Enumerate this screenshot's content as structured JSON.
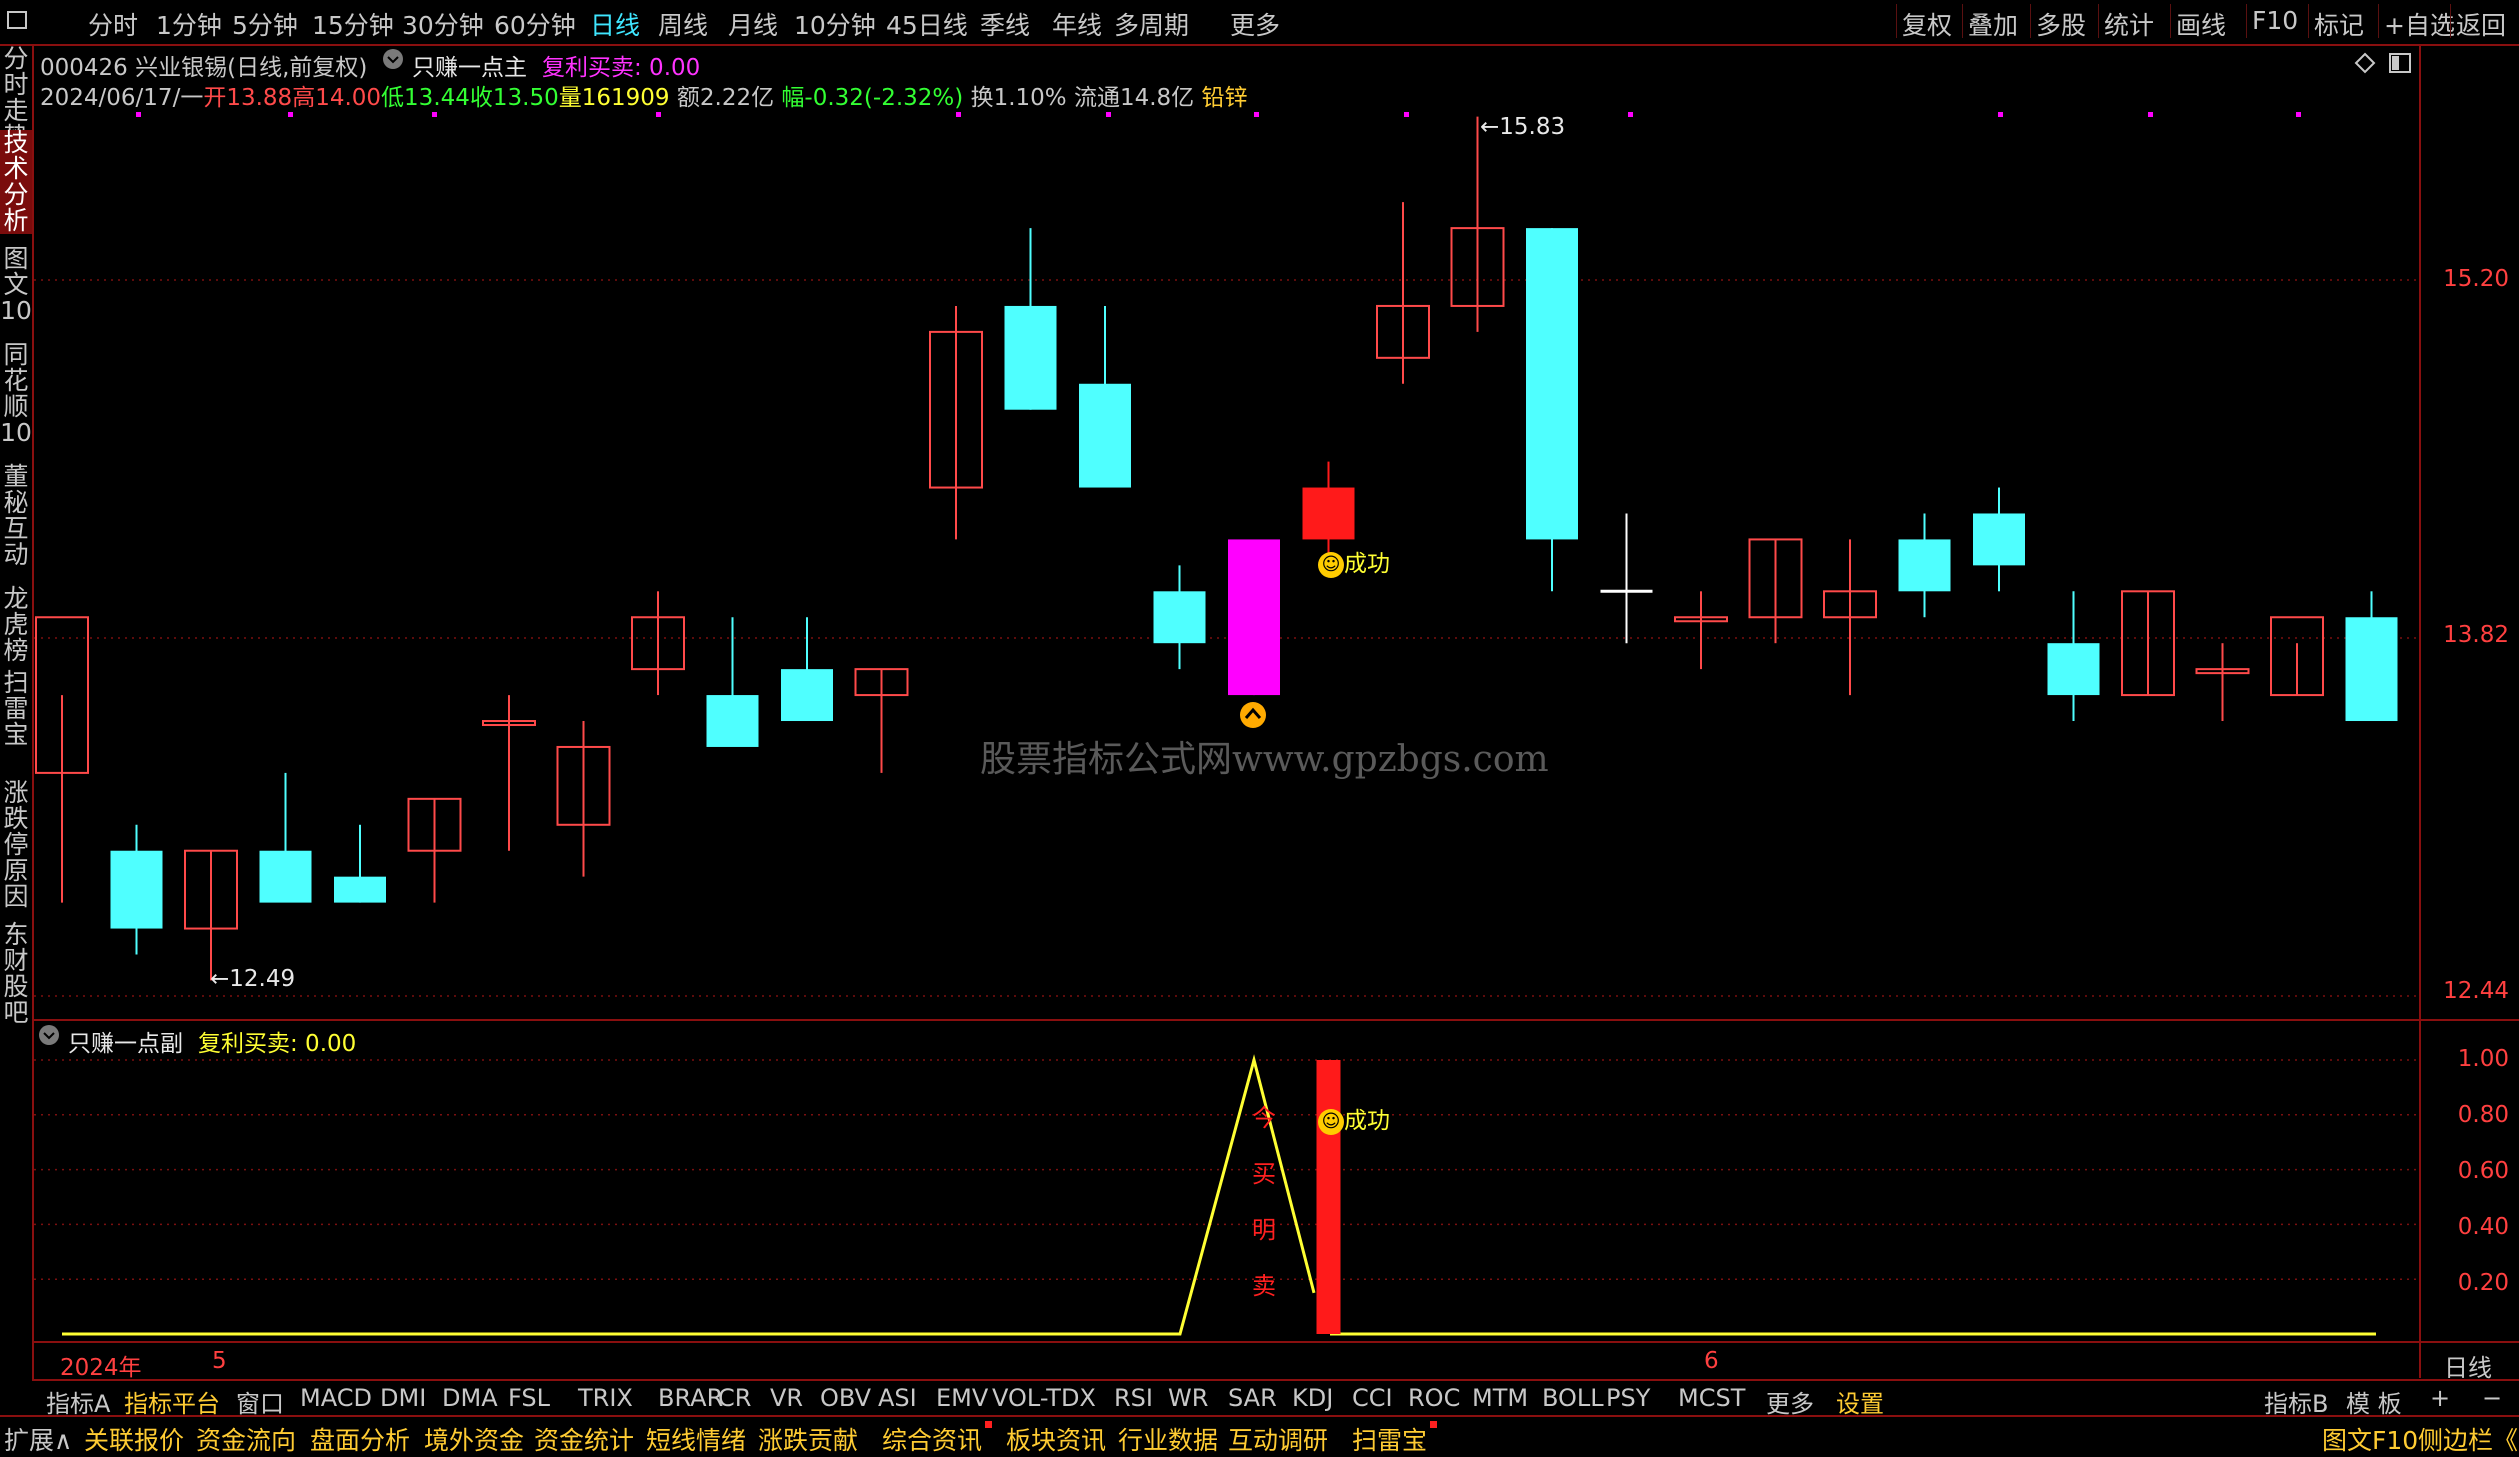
{
  "toolbar": {
    "periods": [
      "分时",
      "1分钟",
      "5分钟",
      "15分钟",
      "30分钟",
      "60分钟",
      "日线",
      "周线",
      "月线",
      "10分钟",
      "45日线",
      "季线",
      "年线",
      "多周期",
      "更多"
    ],
    "active_period": "日线",
    "right_tools": [
      "复权",
      "叠加",
      "多股",
      "统计",
      "画线",
      "F10",
      "标记",
      "+自选",
      "返回"
    ]
  },
  "left_tabs": [
    "分时走势",
    "技术分析",
    "图文10",
    "同花顺10",
    "董秘互动",
    "龙虎榜",
    "扫雷宝",
    "涨跌停原因",
    "东财股吧"
  ],
  "left_active": "技术分析",
  "header": {
    "title": "000426 兴业银锡(日线,前复权)",
    "indicator_name": "只赚一点主",
    "indicator_value": "复利买卖: 0.00",
    "date": "2024/06/17/一",
    "open_label": "开",
    "open": "13.88",
    "high_label": "高",
    "high": "14.00",
    "low_label": "低",
    "low": "13.44",
    "close_label": "收",
    "close": "13.50",
    "vol_label": "量",
    "vol": "161909",
    "amt": "额2.22亿",
    "chg": "幅-0.32(-2.32%)",
    "turnover": "换1.10%",
    "float": "流通14.8亿",
    "sector": "铅锌"
  },
  "chart_data": {
    "type": "candlestick",
    "y_ticks": [
      "15.20",
      "13.82",
      "12.44"
    ],
    "high_mark": "15.83",
    "low_mark": "12.49",
    "candles": [
      {
        "o": 13.3,
        "h": 13.6,
        "l": 12.8,
        "c": 13.9
      },
      {
        "o": 13.0,
        "h": 13.1,
        "l": 12.6,
        "c": 12.7
      },
      {
        "o": 12.7,
        "h": 13.0,
        "l": 12.5,
        "c": 13.0
      },
      {
        "o": 13.0,
        "h": 13.3,
        "l": 12.9,
        "c": 12.8
      },
      {
        "o": 12.9,
        "h": 13.1,
        "l": 12.8,
        "c": 12.8
      },
      {
        "o": 13.0,
        "h": 13.2,
        "l": 12.8,
        "c": 13.2
      },
      {
        "o": 13.5,
        "h": 13.6,
        "l": 13.0,
        "c": 13.5
      },
      {
        "o": 13.1,
        "h": 13.5,
        "l": 12.9,
        "c": 13.4
      },
      {
        "o": 13.7,
        "h": 14.0,
        "l": 13.6,
        "c": 13.9
      },
      {
        "o": 13.6,
        "h": 13.9,
        "l": 13.5,
        "c": 13.4
      },
      {
        "o": 13.7,
        "h": 13.9,
        "l": 13.5,
        "c": 13.5
      },
      {
        "o": 13.6,
        "h": 13.7,
        "l": 13.3,
        "c": 13.7
      },
      {
        "o": 14.4,
        "h": 15.1,
        "l": 14.2,
        "c": 15.0
      },
      {
        "o": 15.1,
        "h": 15.4,
        "l": 14.7,
        "c": 14.7
      },
      {
        "o": 14.8,
        "h": 15.1,
        "l": 14.5,
        "c": 14.4
      },
      {
        "o": 14.0,
        "h": 14.1,
        "l": 13.7,
        "c": 13.8
      },
      {
        "o": 13.6,
        "h": 14.0,
        "l": 13.6,
        "c": 14.2
      },
      {
        "o": 14.4,
        "h": 14.5,
        "l": 14.1,
        "c": 14.2
      },
      {
        "o": 14.9,
        "h": 15.5,
        "l": 14.8,
        "c": 15.1
      },
      {
        "o": 15.1,
        "h": 15.83,
        "l": 15.0,
        "c": 15.4
      },
      {
        "o": 15.4,
        "h": 15.4,
        "l": 14.0,
        "c": 14.2
      },
      {
        "o": 14.0,
        "h": 14.3,
        "l": 13.8,
        "c": 14.0
      },
      {
        "o": 13.9,
        "h": 14.0,
        "l": 13.7,
        "c": 13.9
      },
      {
        "o": 13.9,
        "h": 14.2,
        "l": 13.8,
        "c": 14.2
      },
      {
        "o": 13.9,
        "h": 14.2,
        "l": 13.6,
        "c": 14.0
      },
      {
        "o": 14.2,
        "h": 14.3,
        "l": 13.9,
        "c": 14.0
      },
      {
        "o": 14.3,
        "h": 14.4,
        "l": 14.0,
        "c": 14.1
      },
      {
        "o": 13.8,
        "h": 14.0,
        "l": 13.5,
        "c": 13.6
      },
      {
        "o": 13.6,
        "h": 14.0,
        "l": 13.6,
        "c": 14.0
      },
      {
        "o": 13.7,
        "h": 13.8,
        "l": 13.5,
        "c": 13.7
      },
      {
        "o": 13.6,
        "h": 13.8,
        "l": 13.6,
        "c": 13.9
      },
      {
        "o": 13.9,
        "h": 14.0,
        "l": 13.6,
        "c": 13.5
      }
    ],
    "signals": {
      "success_text": "成功"
    }
  },
  "sub_panel": {
    "name": "只赚一点副",
    "value": "复利买卖: 0.00",
    "y_ticks": [
      "1.00",
      "0.80",
      "0.60",
      "0.40",
      "0.20"
    ],
    "vertical_text": [
      "今",
      "买",
      "明",
      "卖"
    ],
    "success_text": "成功"
  },
  "x_axis": {
    "year_label": "2024年",
    "month_5": "5",
    "month_6": "6",
    "period_label": "日线"
  },
  "watermark": "股票指标公式网www.gpzbgs.com",
  "indicator_tabs": [
    "指标A",
    "指标平台",
    "窗口",
    "MACD",
    "DMI",
    "DMA",
    "FSL",
    "TRIX",
    "BRAR",
    "CR",
    "VR",
    "OBV",
    "ASI",
    "EMV",
    "VOL-TDX",
    "RSI",
    "WR",
    "SAR",
    "KDJ",
    "CCI",
    "ROC",
    "MTM",
    "BOLL",
    "PSY",
    "MCST",
    "更多",
    "设置"
  ],
  "indicator_right": [
    "指标B",
    "模 板",
    "+",
    "−"
  ],
  "ext_tabs": [
    "扩展∧",
    "关联报价",
    "资金流向",
    "盘面分析",
    "境外资金",
    "资金统计",
    "短线情绪",
    "涨跌贡献",
    "综合资讯",
    "板块资讯",
    "行业数据",
    "互动调研",
    "扫雷宝"
  ],
  "ext_right": [
    "图文F10",
    "侧边栏《"
  ],
  "colors": {
    "up": "#ff4a4a",
    "down": "#4fffff",
    "signal": "#ff00ff",
    "yellow": "#ffff33",
    "red_bar": "#ff1a1a",
    "grid": "#7a0f0f"
  }
}
